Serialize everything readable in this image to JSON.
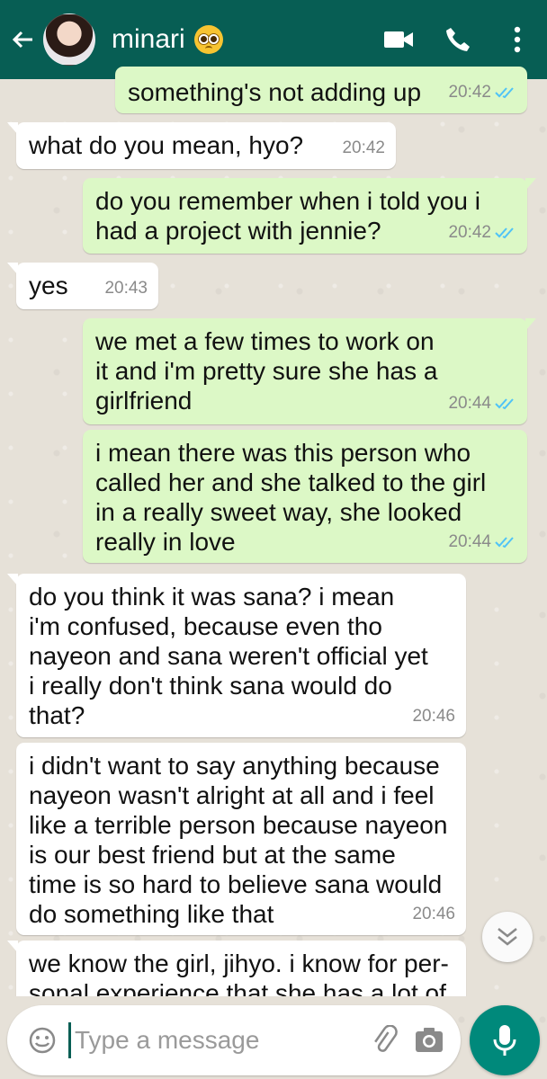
{
  "header": {
    "contact_name": "minari",
    "status_emoji": "pleading-face"
  },
  "messages": [
    {
      "dir": "out",
      "text": "something's not adding up",
      "time": "20:42",
      "read": true
    },
    {
      "dir": "in",
      "text": "what do you mean, hyo?",
      "time": "20:42"
    },
    {
      "dir": "out",
      "text": "do you remember when i told you i\nhad a project with jennie?",
      "time": "20:42",
      "read": true
    },
    {
      "dir": "in",
      "text": "yes",
      "time": "20:43"
    },
    {
      "dir": "out",
      "text": "we met a few times to work on\nit and i'm pretty sure she has a\ngirlfriend",
      "time": "20:44",
      "read": true
    },
    {
      "dir": "out",
      "text": "i mean there was this person who\ncalled her and she talked to the girl\nin a really sweet way, she looked\nreally in love",
      "time": "20:44",
      "read": true
    },
    {
      "dir": "in",
      "text": "do you think it was sana? i mean\ni'm confused, because even tho\nnayeon and sana weren't official yet\ni really don't think sana would do\nthat?",
      "time": "20:46"
    },
    {
      "dir": "in",
      "text": "i didn't want to say anything because\nnayeon wasn't alright at all and i feel\nlike a terrible person because nayeon\nis our best friend but at the same\ntime is so hard to believe sana would\ndo something like that",
      "time": "20:46"
    },
    {
      "dir": "in",
      "text": "we know the girl, jihyo. i know for per-\nsonal experience that she has a lot of",
      "time": ""
    }
  ],
  "composer": {
    "placeholder": "Type a message"
  },
  "colors": {
    "header": "#075e54",
    "outgoing_bubble": "#dcf8c6",
    "incoming_bubble": "#ffffff",
    "read_tick": "#4fc3f7",
    "mic_button": "#00897b"
  }
}
